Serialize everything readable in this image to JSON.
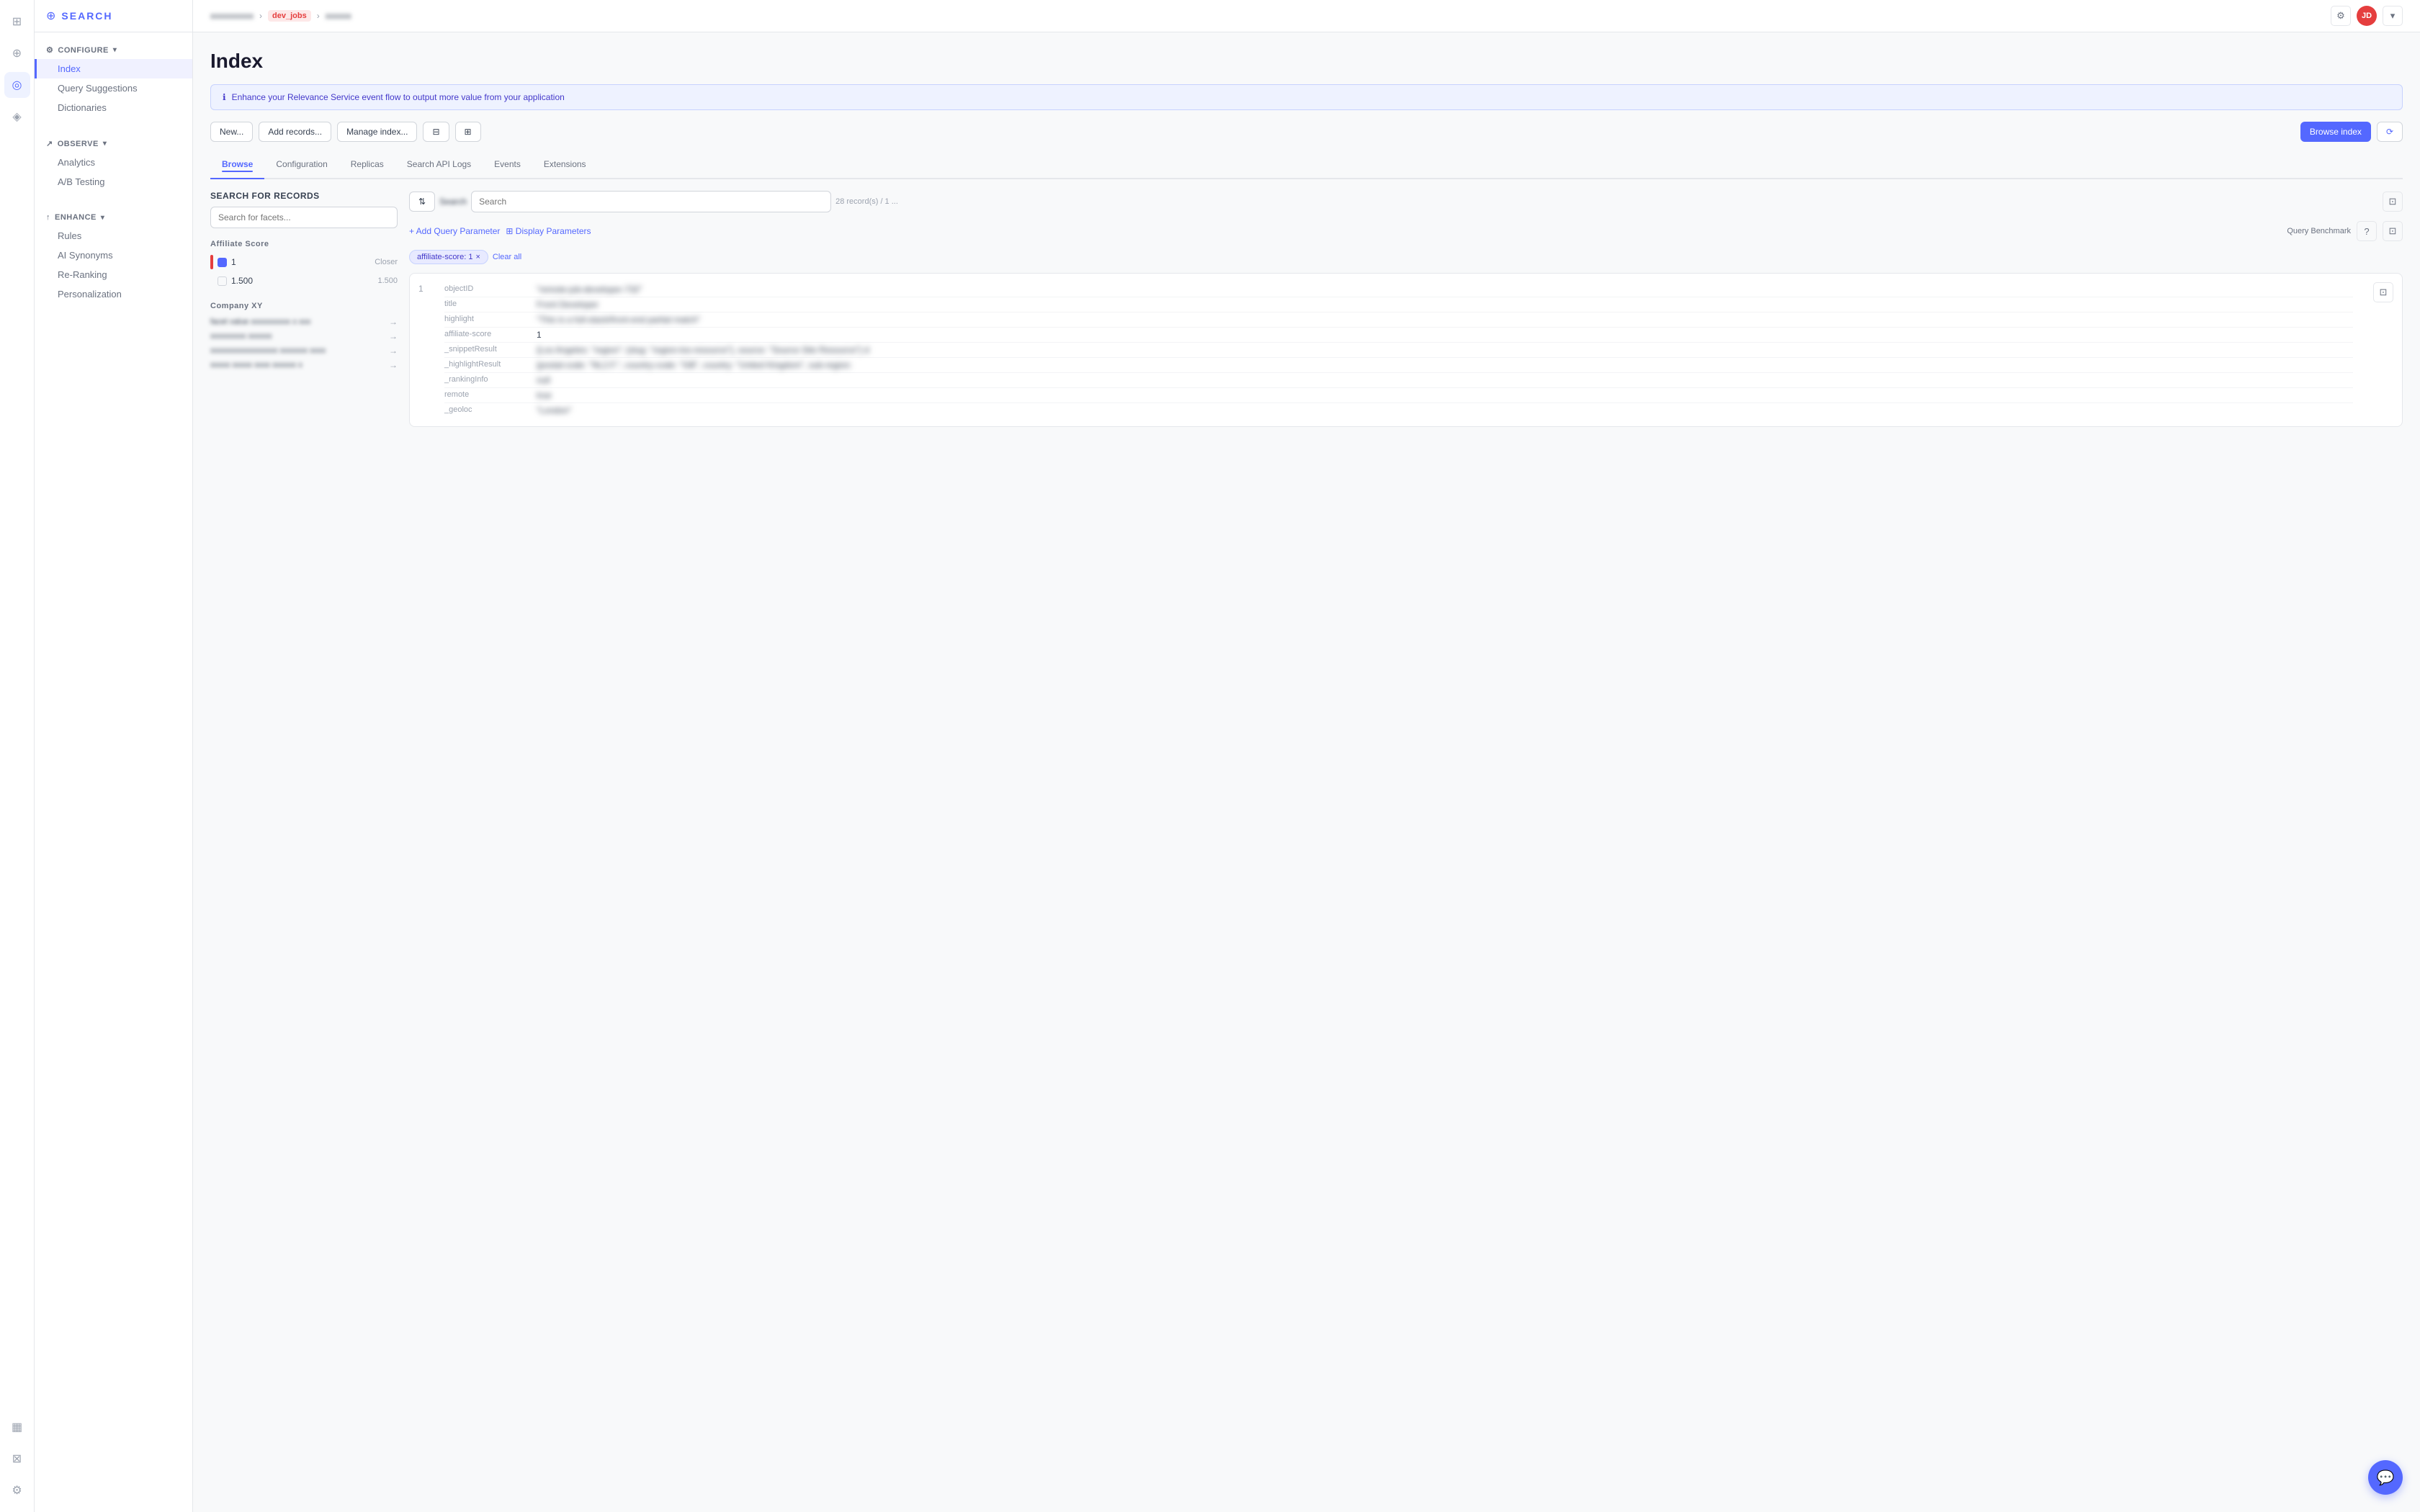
{
  "leftNav": {
    "items": [
      {
        "id": "home",
        "icon": "⊞",
        "label": "Home",
        "active": false
      },
      {
        "id": "search",
        "icon": "⊕",
        "label": "Search",
        "active": false
      },
      {
        "id": "explore",
        "icon": "◎",
        "label": "Explore",
        "active": true
      },
      {
        "id": "discover",
        "icon": "◈",
        "label": "Discover",
        "active": false
      }
    ],
    "bottomItems": [
      {
        "id": "chart",
        "icon": "▦",
        "label": "Analytics"
      },
      {
        "id": "database",
        "icon": "⊠",
        "label": "Database"
      },
      {
        "id": "settings",
        "icon": "⚙",
        "label": "Settings"
      }
    ]
  },
  "sidebar": {
    "logoText": "SEARCH",
    "configure": {
      "label": "CONFIGURE",
      "chevron": "▾",
      "items": [
        {
          "id": "index",
          "label": "Index",
          "active": true
        },
        {
          "id": "query-suggestions",
          "label": "Query Suggestions",
          "active": false
        },
        {
          "id": "dictionaries",
          "label": "Dictionaries",
          "active": false
        }
      ]
    },
    "observe": {
      "label": "OBSERVE",
      "chevron": "▾",
      "items": [
        {
          "id": "analytics",
          "label": "Analytics",
          "active": false
        },
        {
          "id": "ab-testing",
          "label": "A/B Testing",
          "active": false
        }
      ]
    },
    "enhance": {
      "label": "ENHANCE",
      "chevron": "▾",
      "items": [
        {
          "id": "rules",
          "label": "Rules",
          "active": false
        },
        {
          "id": "ai-synonyms",
          "label": "AI Synonyms",
          "active": false
        },
        {
          "id": "re-ranking",
          "label": "Re-Ranking",
          "active": false
        },
        {
          "id": "personalization",
          "label": "Personalization",
          "active": false
        }
      ]
    }
  },
  "topBar": {
    "breadcrumb1": "xxxxxxxxxx",
    "badge1": "dev_jobs",
    "breadcrumb2": "xxxxxx",
    "settingsIcon": "⚙",
    "avatarText": "JD"
  },
  "page": {
    "title": "Index",
    "infoBanner": "Enhance your Relevance Service event flow to output more value from your application",
    "infoBannerIcon": "ℹ"
  },
  "toolbar": {
    "btn1": "New...",
    "btn2": "Add records...",
    "btn3": "Manage index...",
    "btn4": "",
    "btn5": "",
    "browseLabel": "Browse index",
    "spinnerIcon": "⟳"
  },
  "tabs": [
    {
      "label": "Browse",
      "active": true
    },
    {
      "label": "Configuration",
      "active": false
    },
    {
      "label": "Replicas",
      "active": false
    },
    {
      "label": "Search API Logs",
      "active": false
    },
    {
      "label": "Events",
      "active": false
    },
    {
      "label": "Extensions",
      "active": false
    }
  ],
  "searchPanel": {
    "title": "Search for Records",
    "inputPlaceholder": "Search for facets...",
    "filtersSectionTitle": "Affiliate Score",
    "filters": [
      {
        "label": "1",
        "count": "",
        "checked": true,
        "highlight": true
      },
      {
        "label": "1.500",
        "count": "",
        "checked": false
      }
    ],
    "facetSection": {
      "title": "Company XY",
      "items": [
        {
          "label": "facet value xxxxxxxxxx x xxx",
          "icon": "→"
        },
        {
          "label": "xxxxxxxxx xxxxxx",
          "icon": "→"
        },
        {
          "label": "xxxxxxxxxxxxxxxxx xxxxxxx xxxx",
          "icon": "→"
        },
        {
          "label": "xxxxx xxxxx xxxx xxxxxx x",
          "icon": "→"
        }
      ]
    }
  },
  "results": {
    "searchPlaceholder": "Search",
    "sortIcon": "⇅",
    "filterIcon": "⊟",
    "countText": "28 record(s) / 1 ...",
    "addQueryParam": "+ Add Query Parameter",
    "addDisplayParam": "⊞ Display Parameters",
    "queryBenchmarkLabel": "Query Benchmark",
    "activeFilter": "affiliate-score: 1",
    "activeFilterX": "×",
    "clearAll": "Clear all",
    "records": [
      {
        "index": "1",
        "fields": [
          {
            "key": "objectID",
            "value": "\"remote-job-developer-732\""
          },
          {
            "key": "title",
            "value": "Front Developer"
          },
          {
            "key": "highlight",
            "value": "\"This is a full-stack/front-end partial match\""
          },
          {
            "key": "affiliate-score",
            "value": "1"
          },
          {
            "key": "_snippetResult",
            "value": "{Los Angeles: \"region\": {slug: \"region-los-resource\"}, source: \"Source Site Resource\"} d"
          },
          {
            "key": "_highlightResult",
            "value": "{postal-code: \"NL2.F.\", country-code: \"GB\", country: \"United Kingdom\", sub-region:"
          },
          {
            "key": "_rankingInfo",
            "value": "null"
          },
          {
            "key": "remote",
            "value": "true"
          },
          {
            "key": "_geoloc",
            "value": "\"London\""
          }
        ]
      }
    ]
  },
  "chatBtn": {
    "icon": "💬"
  }
}
